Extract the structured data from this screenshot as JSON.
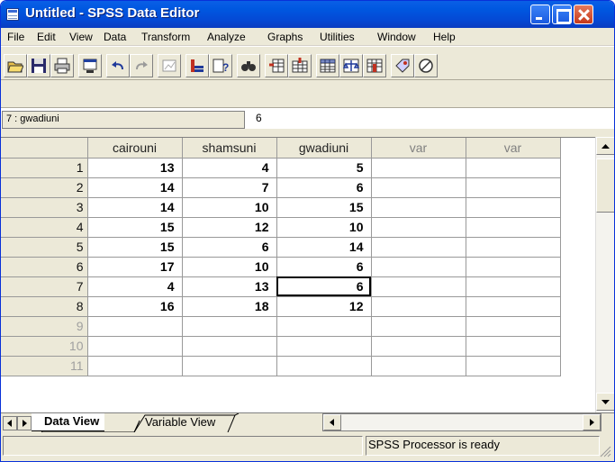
{
  "window": {
    "title": "Untitled - SPSS Data Editor"
  },
  "menu": [
    "File",
    "Edit",
    "View",
    "Data",
    "Transform",
    "Analyze",
    "Graphs",
    "Utilities",
    "Window",
    "Help"
  ],
  "toolbar": {
    "icons": [
      "open-icon",
      "save-icon",
      "print-icon",
      "dialog-recall-icon",
      "undo-icon",
      "redo-icon",
      "goto-chart-icon",
      "goto-case-icon",
      "variables-icon",
      "find-icon",
      "insert-case-icon",
      "insert-variable-icon",
      "split-file-icon",
      "weight-cases-icon",
      "select-cases-icon",
      "value-labels-icon",
      "use-sets-icon"
    ]
  },
  "cell_editor": {
    "reference": "7 : gwadiuni",
    "value": "6"
  },
  "grid": {
    "columns": [
      "cairouni",
      "shamsuni",
      "gwadiuni",
      "var",
      "var"
    ],
    "rows": [
      {
        "num": "1",
        "values": [
          "13",
          "4",
          "5"
        ]
      },
      {
        "num": "2",
        "values": [
          "14",
          "7",
          "6"
        ]
      },
      {
        "num": "3",
        "values": [
          "14",
          "10",
          "15"
        ]
      },
      {
        "num": "4",
        "values": [
          "15",
          "12",
          "10"
        ]
      },
      {
        "num": "5",
        "values": [
          "15",
          "6",
          "14"
        ]
      },
      {
        "num": "6",
        "values": [
          "17",
          "10",
          "6"
        ]
      },
      {
        "num": "7",
        "values": [
          "4",
          "13",
          "6"
        ]
      },
      {
        "num": "8",
        "values": [
          "16",
          "18",
          "12"
        ]
      },
      {
        "num": "9",
        "values": [
          "",
          "",
          ""
        ]
      },
      {
        "num": "10",
        "values": [
          "",
          "",
          ""
        ]
      },
      {
        "num": "11",
        "values": [
          "",
          "",
          ""
        ]
      }
    ],
    "selected": {
      "row": "7",
      "column": "gwadiuni"
    }
  },
  "tabs": {
    "data_view": "Data View",
    "variable_view": "Variable View"
  },
  "status": {
    "text": "SPSS Processor  is ready"
  }
}
